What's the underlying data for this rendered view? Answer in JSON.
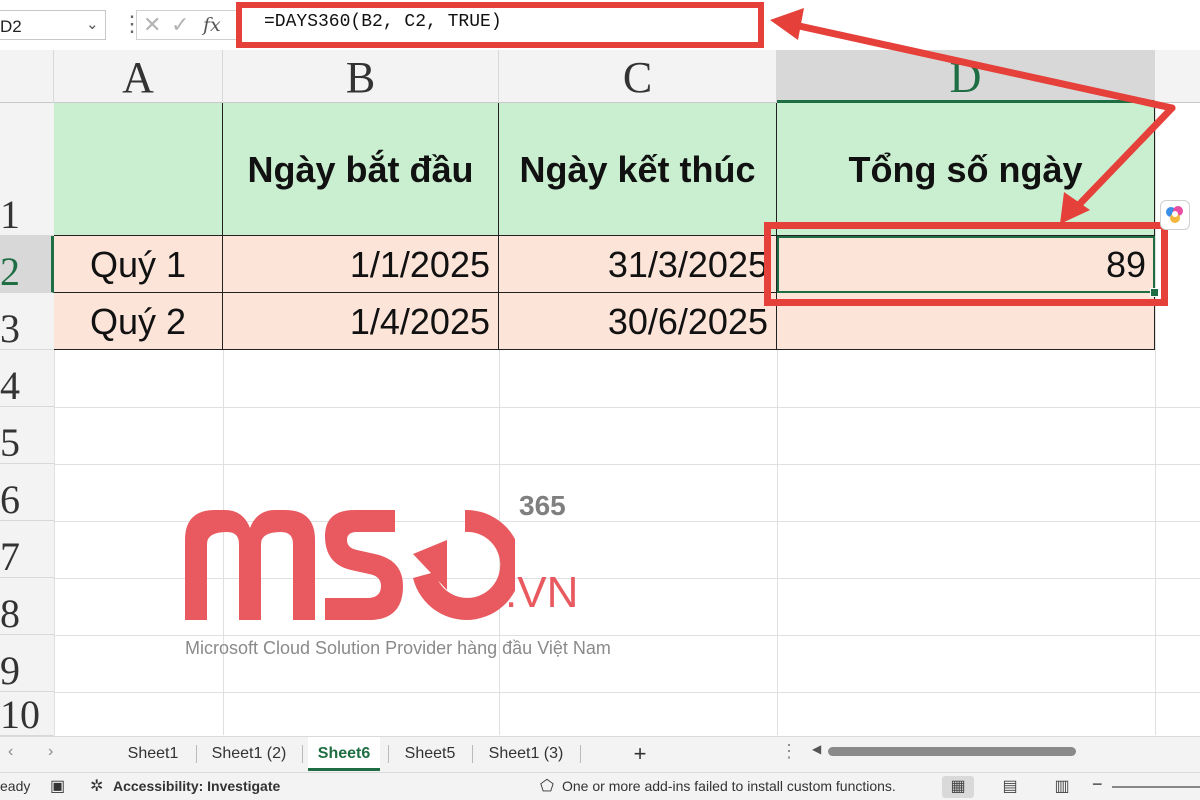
{
  "formula_bar": {
    "name_box": "D2",
    "fx_label": "fx",
    "formula": "=DAYS360(B2, C2, TRUE)"
  },
  "columns": [
    "A",
    "B",
    "C",
    "D"
  ],
  "rows": [
    "1",
    "2",
    "3",
    "4",
    "5",
    "6",
    "7",
    "8",
    "9",
    "10"
  ],
  "table": {
    "headers": [
      "",
      "Ngày bắt đầu",
      "Ngày kết thúc",
      "Tổng số ngày"
    ],
    "rows": [
      [
        "Quý 1",
        "1/1/2025",
        "31/3/2025",
        "89"
      ],
      [
        "Quý 2",
        "1/4/2025",
        "30/6/2025",
        ""
      ]
    ]
  },
  "watermark": {
    "logo_text": "MSO",
    "superscript": "365",
    "suffix": ".VN",
    "tagline": "Microsoft Cloud Solution Provider hàng đầu Việt Nam"
  },
  "sheet_tabs": {
    "tabs": [
      "Sheet1",
      "Sheet1 (2)",
      "Sheet6",
      "Sheet5",
      "Sheet1 (3)"
    ],
    "active": "Sheet6",
    "add_label": "+"
  },
  "status_bar": {
    "ready": "eady",
    "accessibility": "Accessibility: Investigate",
    "addins_message": "One or more add-ins failed to install custom functions."
  },
  "colors": {
    "header_fill": "#c9efd0",
    "data_fill": "#fce4d9",
    "highlight_red": "#e6403a",
    "excel_green": "#1f6e43",
    "logo_red": "#e85a5f"
  }
}
